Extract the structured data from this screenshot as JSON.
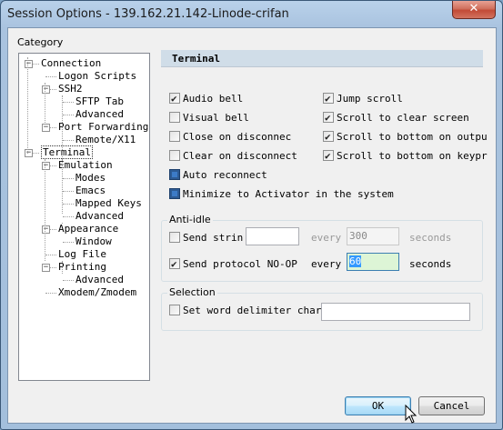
{
  "window": {
    "title": "Session Options - 139.162.21.142-Linode-crifan",
    "close_glyph": "✕"
  },
  "category": {
    "label": "Category",
    "items": [
      {
        "label": "Connection"
      },
      {
        "label": "Logon Scripts"
      },
      {
        "label": "SSH2"
      },
      {
        "label": "SFTP Tab"
      },
      {
        "label": "Advanced"
      },
      {
        "label": "Port Forwarding"
      },
      {
        "label": "Remote/X11"
      },
      {
        "label": "Terminal",
        "selected": true
      },
      {
        "label": "Emulation"
      },
      {
        "label": "Modes"
      },
      {
        "label": "Emacs"
      },
      {
        "label": "Mapped Keys"
      },
      {
        "label": "Advanced"
      },
      {
        "label": "Appearance"
      },
      {
        "label": "Window"
      },
      {
        "label": "Log File"
      },
      {
        "label": "Printing"
      },
      {
        "label": "Advanced"
      },
      {
        "label": "Xmodem/Zmodem"
      }
    ],
    "expander_minus": "−"
  },
  "panel": {
    "title": "Terminal",
    "options": [
      {
        "label": "Audio bell",
        "checked": true
      },
      {
        "label": "Visual bell",
        "checked": false
      },
      {
        "label": "Close on disconnec",
        "checked": false
      },
      {
        "label": "Clear on disconnect",
        "checked": false
      },
      {
        "label": "Auto reconnect",
        "state": "filled"
      },
      {
        "label": "Minimize to Activator in the system",
        "state": "filled"
      },
      {
        "label": "Jump scroll",
        "checked": true
      },
      {
        "label": "Scroll to clear screen",
        "checked": true
      },
      {
        "label": "Scroll to bottom on outpu",
        "checked": true
      },
      {
        "label": "Scroll to bottom on keypr",
        "checked": true
      }
    ]
  },
  "anti_idle": {
    "title": "Anti-idle",
    "send_string": {
      "label": "Send strin",
      "checked": false,
      "value": ""
    },
    "every1": {
      "label": "every",
      "value": "300",
      "unit": "seconds"
    },
    "send_noop": {
      "label": "Send protocol NO-OP",
      "checked": true
    },
    "every2": {
      "label": "every",
      "value": "60",
      "unit": "seconds"
    }
  },
  "selection": {
    "title": "Selection",
    "word_delim": {
      "label": "Set word delimiter chara",
      "checked": false,
      "value": ""
    }
  },
  "buttons": {
    "ok": "OK",
    "cancel": "Cancel"
  }
}
